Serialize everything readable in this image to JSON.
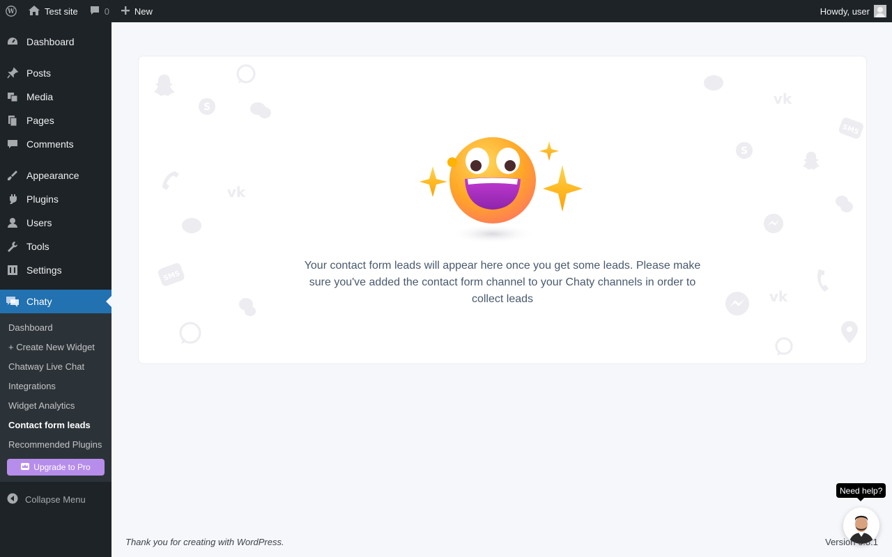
{
  "admin_bar": {
    "site_name": "Test site",
    "comments_count": "0",
    "new_label": "New",
    "greeting": "Howdy, user"
  },
  "sidebar": {
    "items": [
      {
        "label": "Dashboard",
        "icon": "dashboard-icon"
      },
      {
        "label": "Posts",
        "icon": "pin-icon"
      },
      {
        "label": "Media",
        "icon": "media-icon"
      },
      {
        "label": "Pages",
        "icon": "pages-icon"
      },
      {
        "label": "Comments",
        "icon": "comment-icon"
      },
      {
        "label": "Appearance",
        "icon": "brush-icon"
      },
      {
        "label": "Plugins",
        "icon": "plugin-icon"
      },
      {
        "label": "Users",
        "icon": "user-icon"
      },
      {
        "label": "Tools",
        "icon": "wrench-icon"
      },
      {
        "label": "Settings",
        "icon": "settings-icon"
      }
    ],
    "current": {
      "label": "Chaty",
      "icon": "chat-bubble-icon"
    },
    "submenu": [
      "Dashboard",
      "+ Create New Widget",
      "Chatway Live Chat",
      "Integrations",
      "Widget Analytics",
      "Contact form leads",
      "Recommended Plugins"
    ],
    "active_submenu": "Contact form leads",
    "upgrade_label": "Upgrade to Pro",
    "collapse_label": "Collapse Menu"
  },
  "main": {
    "message": "Your contact form leads will appear here once you get some leads. Please make sure you've added the contact form channel to your Chaty channels in order to collect leads"
  },
  "footer": {
    "thanks": "Thank you for creating with WordPress.",
    "version": "Version 6.8.1"
  },
  "help_widget": {
    "tooltip": "Need help?"
  },
  "colors": {
    "admin_bg": "#1d2327",
    "accent": "#2271b1",
    "upgrade": "#b78deb",
    "text_message": "#49596d"
  }
}
